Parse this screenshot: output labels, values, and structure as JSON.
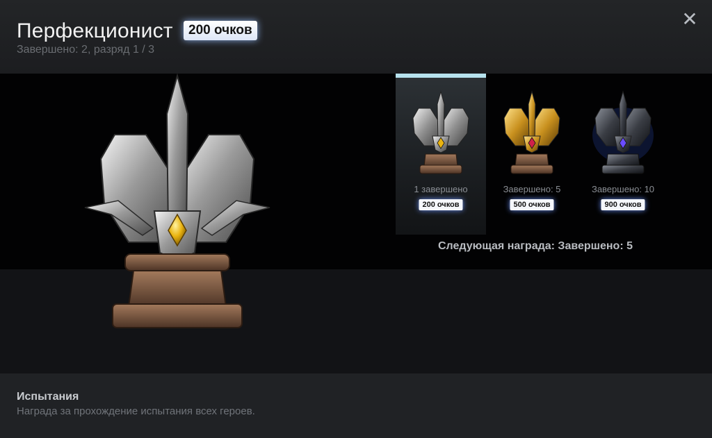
{
  "header": {
    "title": "Перфекционист",
    "points": "200 очков",
    "subtitle": "Завершено: 2, разряд 1 / 3",
    "close_icon": "close-icon"
  },
  "tiers": [
    {
      "label": "1 завершено",
      "points": "200 очков",
      "style": "silver",
      "gem": "#e9b310",
      "active": true
    },
    {
      "label": "Завершено: 5",
      "points": "500 очков",
      "style": "gold",
      "gem": "#d0204a",
      "active": false
    },
    {
      "label": "Завершено: 10",
      "points": "900 очков",
      "style": "dark",
      "gem": "#6a4cff",
      "active": false
    }
  ],
  "next_reward": "Следующая награда:  Завершено: 5",
  "footer": {
    "title": "Испытания",
    "description": "Награда за прохождение испытания всех героев."
  },
  "colors": {
    "badge_glow": "#96beff",
    "active_tier_border": "#b6e2ee"
  }
}
